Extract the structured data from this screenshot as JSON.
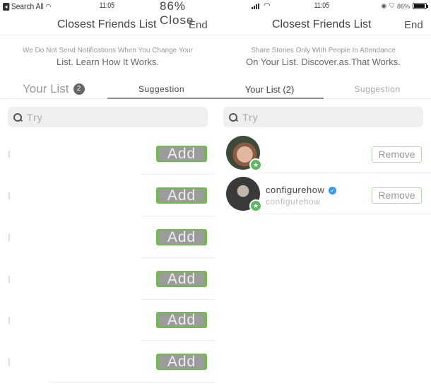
{
  "left_pane": {
    "status_bar": {
      "carrier": "Search All",
      "time": "11:05",
      "overlay_text": "86% Close"
    },
    "nav": {
      "title": "Closest Friends List",
      "done": "End"
    },
    "info": {
      "line1": "We Do Not Send Notifications When You Change Your",
      "line2": "List. Learn How It Works."
    },
    "tabs": [
      {
        "label": "Your List",
        "badge": "2",
        "active": false
      },
      {
        "label": "Suggestion",
        "active": true
      }
    ],
    "search": {
      "placeholder": "Try"
    },
    "suggestions": [
      {
        "button": "Add"
      },
      {
        "button": "Add"
      },
      {
        "button": "Add"
      },
      {
        "button": "Add"
      },
      {
        "button": "Add"
      },
      {
        "button": "Add"
      }
    ]
  },
  "right_pane": {
    "status_bar": {
      "time": "11:05",
      "battery": "86%"
    },
    "nav": {
      "title": "Closest Friends List",
      "done": "End"
    },
    "info": {
      "line1": "Share Stories Only With People In Attendance",
      "line2": "On Your List. Discover.as.That Works."
    },
    "tabs": [
      {
        "label": "Your List (2)",
        "active": true
      },
      {
        "label": "Suggestion",
        "active": false
      }
    ],
    "search": {
      "placeholder": "Try"
    },
    "friends": [
      {
        "username": "",
        "full_name": "",
        "verified": false,
        "button": "Remove"
      },
      {
        "username": "configurehow",
        "full_name": "configurehow",
        "verified": true,
        "button": "Remove"
      }
    ]
  },
  "icons": {
    "close_friend_star": "★",
    "verified_check": "✓",
    "wifi": "wifi-icon",
    "search": "search-icon"
  },
  "colors": {
    "accent_green": "#6cbd4a",
    "verified_blue": "#3897f0",
    "star_badge": "#5cb85c"
  }
}
